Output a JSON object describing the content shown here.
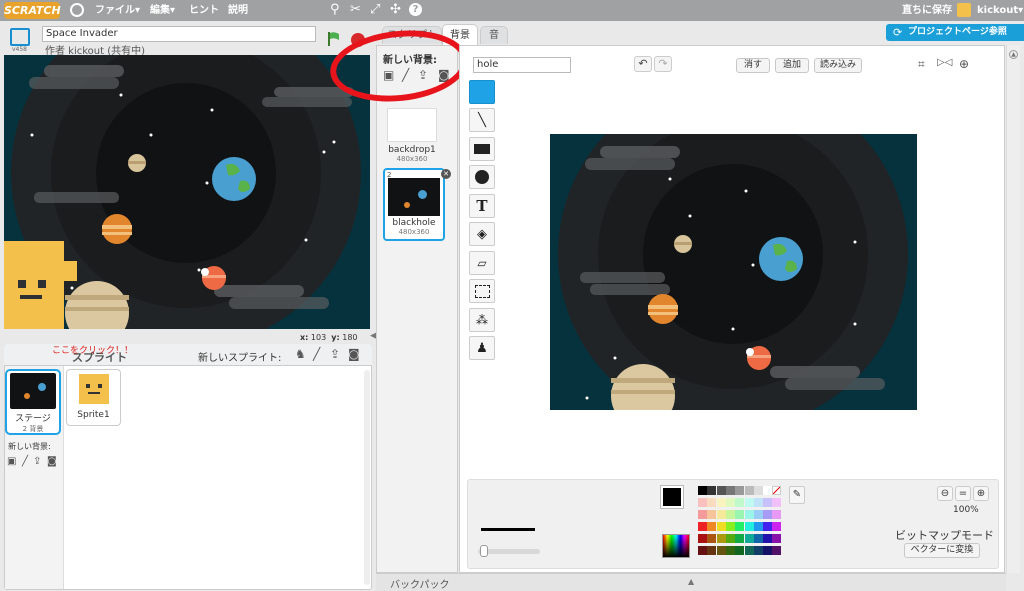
{
  "menubar": {
    "logo": "SCRATCH",
    "file": "ファイル▾",
    "edit": "編集▾",
    "hints": "ヒント",
    "about": "説明",
    "save_now": "直ちに保存",
    "user": "kickout▾"
  },
  "project": {
    "title": "Space Invader",
    "author": "作者 kickout (共有中)",
    "version": "v458",
    "see_project_page": "プロジェクトページ参照"
  },
  "tabs": {
    "scripts": "スクリプト",
    "backdrops": "背景",
    "sounds": "音"
  },
  "stage": {
    "x_label": "x:",
    "x_value": "103",
    "y_label": "y:",
    "y_value": "180"
  },
  "sprite_pane": {
    "title": "スプライト",
    "annotation": "ここをクリック！！",
    "new_sprite": "新しいスプライト:",
    "stage_label": "ステージ",
    "stage_sub": "2 背景",
    "sprite1": "Sprite1",
    "new_backdrop": "新しい背景:"
  },
  "backdrops": {
    "new_backdrop": "新しい背景:",
    "items": [
      {
        "index": "",
        "name": "backdrop1",
        "size": "480x360"
      },
      {
        "index": "2",
        "name": "blackhole",
        "size": "480x360"
      }
    ]
  },
  "editor": {
    "name_value": "hole",
    "clear": "消す",
    "add": "追加",
    "import": "読み込み",
    "zoom": "100%",
    "mode": "ビットマップモード",
    "convert": "ベクターに変換"
  },
  "backpack": "バックパック",
  "palette": [
    "#000000",
    "#333333",
    "#555555",
    "#777777",
    "#999999",
    "#bbbbbb",
    "#dddddd",
    "#ffffff",
    "none",
    "#f9c0c0",
    "#f9dcc0",
    "#f9f3c0",
    "#dff9c0",
    "#c0f9cc",
    "#c0f9f1",
    "#c0e3f9",
    "#c8c0f9",
    "#f1c0f9",
    "#f59a9a",
    "#f5c49a",
    "#f5ea9a",
    "#c7f59a",
    "#9af5b0",
    "#9af5e8",
    "#9acdf5",
    "#a69af5",
    "#e69af5",
    "#ee2222",
    "#ee8822",
    "#eedd22",
    "#88ee22",
    "#22ee66",
    "#22eedd",
    "#2299ee",
    "#4422ee",
    "#cc22ee",
    "#aa1111",
    "#aa5511",
    "#aa9911",
    "#55aa11",
    "#11aa44",
    "#11aa99",
    "#1166aa",
    "#2211aa",
    "#8811aa",
    "#661111",
    "#663311",
    "#665511",
    "#336611",
    "#116622",
    "#116655",
    "#113d66",
    "#151166",
    "#501166"
  ]
}
